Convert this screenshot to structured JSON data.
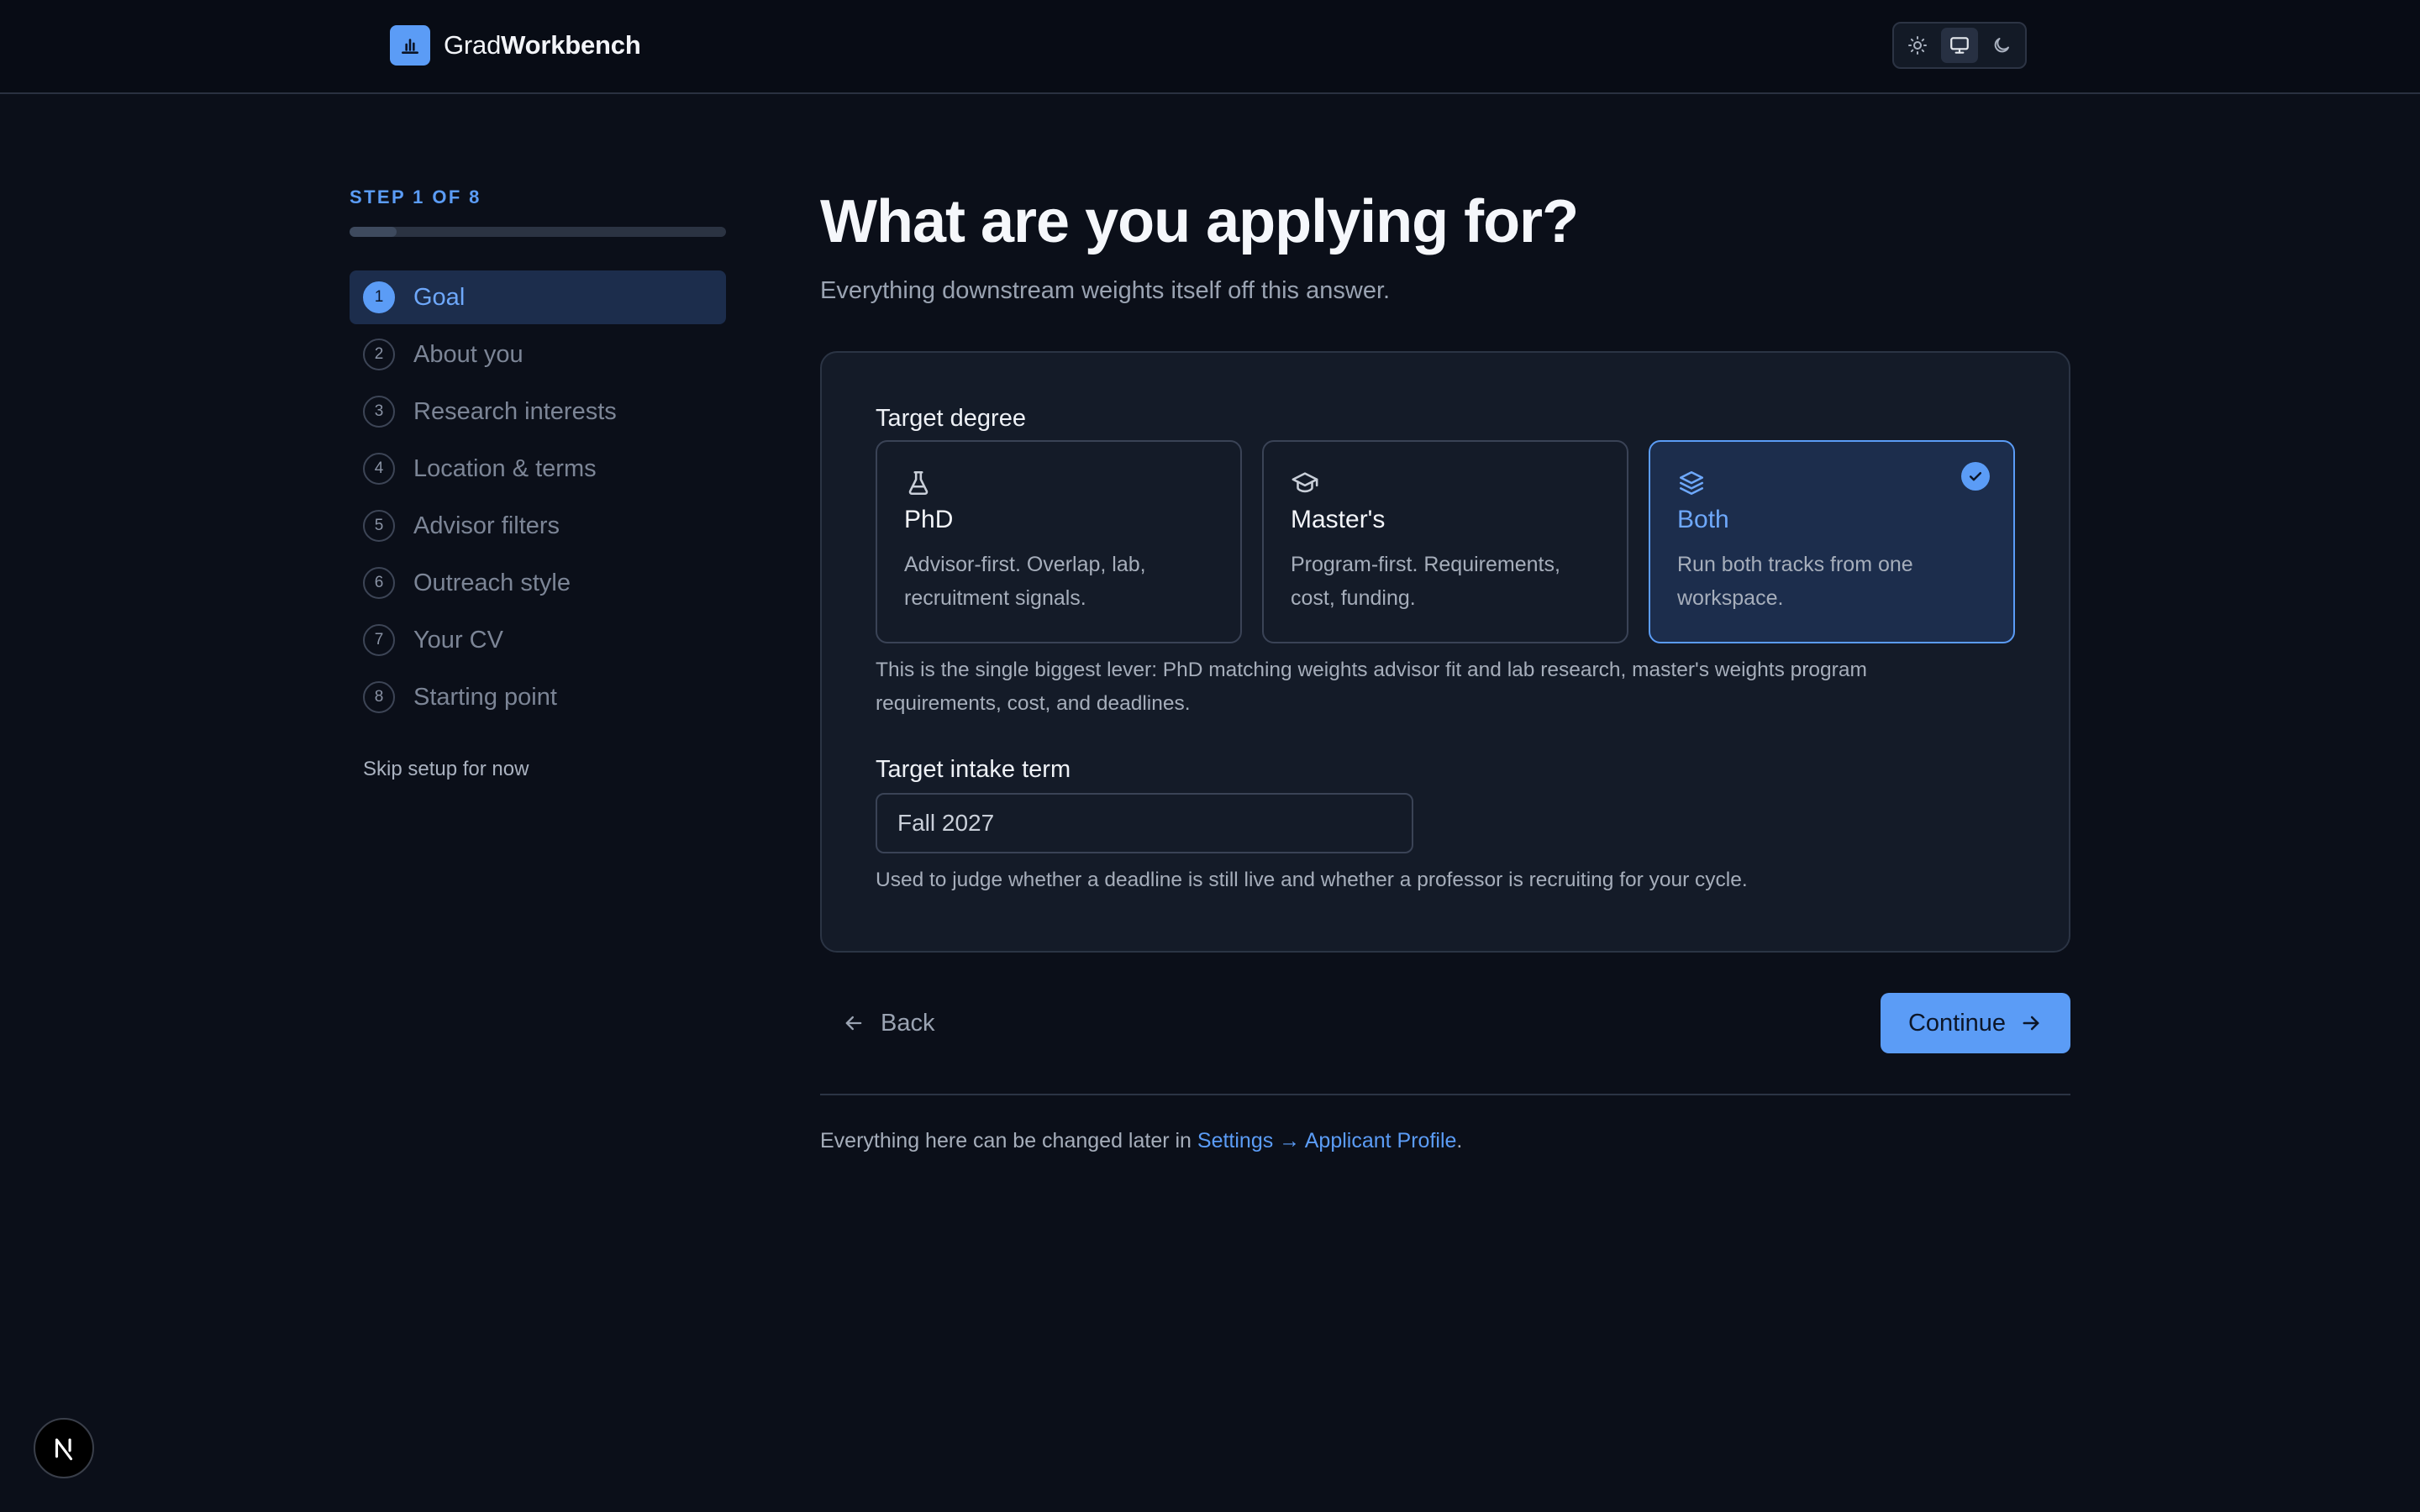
{
  "app": {
    "brand_prefix": "Grad",
    "brand_suffix": "Workbench"
  },
  "theme": {
    "options": [
      "light",
      "system",
      "dark"
    ],
    "active": "system",
    "icons": [
      "sun-icon",
      "monitor-icon",
      "moon-icon"
    ]
  },
  "sidebar": {
    "step_label": "STEP 1 OF 8",
    "progress": 0.125,
    "steps": [
      {
        "num": "1",
        "label": "Goal",
        "active": true
      },
      {
        "num": "2",
        "label": "About you"
      },
      {
        "num": "3",
        "label": "Research interests"
      },
      {
        "num": "4",
        "label": "Location & terms"
      },
      {
        "num": "5",
        "label": "Advisor filters"
      },
      {
        "num": "6",
        "label": "Outreach style"
      },
      {
        "num": "7",
        "label": "Your CV"
      },
      {
        "num": "8",
        "label": "Starting point"
      }
    ],
    "skip": "Skip setup for now"
  },
  "main": {
    "title": "What are you applying for?",
    "subtitle": "Everything downstream weights itself off this answer.",
    "degree": {
      "label": "Target degree",
      "options": [
        {
          "title": "PhD",
          "desc": "Advisor-first. Overlap, lab, recruitment signals.",
          "icon": "flask-icon"
        },
        {
          "title": "Master's",
          "desc": "Program-first. Requirements, cost, funding.",
          "icon": "graduation-cap-icon"
        },
        {
          "title": "Both",
          "desc": "Run both tracks from one workspace.",
          "icon": "layers-icon",
          "selected": true
        }
      ],
      "help": "This is the single biggest lever: PhD matching weights advisor fit and lab research, master's weights program requirements, cost, and deadlines."
    },
    "term": {
      "label": "Target intake term",
      "value": "Fall 2027",
      "help": "Used to judge whether a deadline is still live and whether a professor is recruiting for your cycle."
    },
    "back_label": "Back",
    "continue_label": "Continue",
    "footer_prefix": "Everything here can be changed later in ",
    "footer_link": "Settings → Applicant Profile",
    "footer_suffix": "."
  },
  "colors": {
    "accent": "#5b9cf6",
    "background": "#0b0f19",
    "card": "#141b28"
  }
}
